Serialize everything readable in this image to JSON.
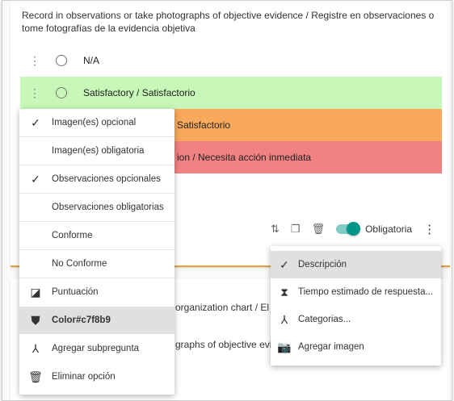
{
  "question": {
    "text": "Record in observations or take photographs of objective evidence / Registre en observaciones o tome fotografías de la evidencia objetiva"
  },
  "options": [
    {
      "label": "N/A",
      "color": "#ffffff"
    },
    {
      "label": "Satisfactory / Satisfactorio",
      "color": "#c7f8b9"
    },
    {
      "label": "Satisfactorio",
      "color": "#f8a95b"
    },
    {
      "label": "ion / Necesita acción inmediata",
      "color": "#f28282"
    }
  ],
  "toolbar": {
    "required_label": "Obligatoria",
    "accent": "#009688"
  },
  "option_menu": {
    "items": [
      {
        "label": "Imagen(es) opcional",
        "checked": true
      },
      {
        "label": "Imagen(es) obligatoria",
        "checked": false
      },
      {
        "label": "Observaciones opcionales",
        "checked": true
      },
      {
        "label": "Observaciones obligatorias",
        "checked": false
      },
      {
        "label": "Conforme",
        "checked": false
      },
      {
        "label": "No Conforme",
        "checked": false
      },
      {
        "label": "Puntuación",
        "icon": "score-icon"
      },
      {
        "label": "Color#c7f8b9",
        "icon": "paint-bucket-icon"
      },
      {
        "label": "Agregar subpregunta",
        "icon": "branch-icon"
      },
      {
        "label": "Eliminar opción",
        "icon": "trash-icon"
      }
    ]
  },
  "question_menu": {
    "items": [
      {
        "label": "Descripción",
        "icon": "check-icon"
      },
      {
        "label": "Tiempo estimado de respuesta...",
        "icon": "hourglass-icon"
      },
      {
        "label": "Categorias...",
        "icon": "branch-icon"
      },
      {
        "label": "Agregar imagen",
        "icon": "add-photo-icon"
      }
    ]
  },
  "bottom_card": {
    "line1": "organization chart / El",
    "line2": "graphs of objective evi"
  }
}
